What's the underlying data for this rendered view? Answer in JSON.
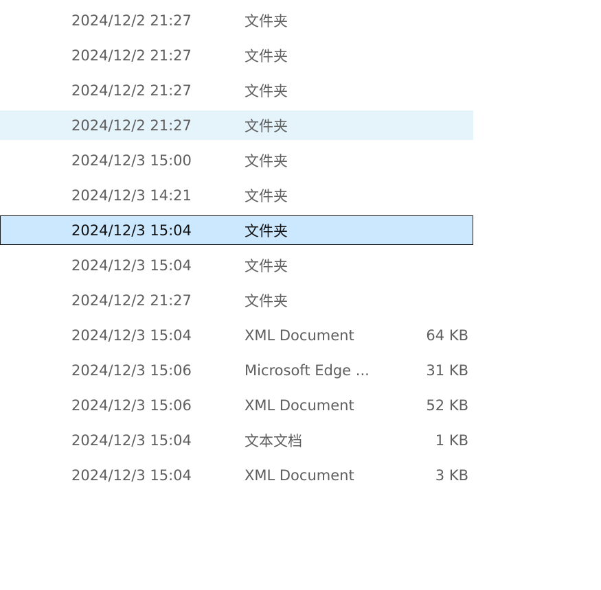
{
  "file_list": {
    "rows": [
      {
        "modified": "2024/12/2 21:27",
        "type": "文件夹",
        "size": "",
        "state": "normal"
      },
      {
        "modified": "2024/12/2 21:27",
        "type": "文件夹",
        "size": "",
        "state": "normal"
      },
      {
        "modified": "2024/12/2 21:27",
        "type": "文件夹",
        "size": "",
        "state": "normal"
      },
      {
        "modified": "2024/12/2 21:27",
        "type": "文件夹",
        "size": "",
        "state": "hover"
      },
      {
        "modified": "2024/12/3 15:00",
        "type": "文件夹",
        "size": "",
        "state": "normal"
      },
      {
        "modified": "2024/12/3 14:21",
        "type": "文件夹",
        "size": "",
        "state": "normal"
      },
      {
        "modified": "2024/12/3 15:04",
        "type": "文件夹",
        "size": "",
        "state": "selected"
      },
      {
        "modified": "2024/12/3 15:04",
        "type": "文件夹",
        "size": "",
        "state": "normal"
      },
      {
        "modified": "2024/12/2 21:27",
        "type": "文件夹",
        "size": "",
        "state": "normal"
      },
      {
        "modified": "2024/12/3 15:04",
        "type": "XML Document",
        "size": "64 KB",
        "state": "normal"
      },
      {
        "modified": "2024/12/3 15:06",
        "type": "Microsoft Edge ...",
        "size": "31 KB",
        "state": "normal"
      },
      {
        "modified": "2024/12/3 15:06",
        "type": "XML Document",
        "size": "52 KB",
        "state": "normal"
      },
      {
        "modified": "2024/12/3 15:04",
        "type": "文本文档",
        "size": "1 KB",
        "state": "normal"
      },
      {
        "modified": "2024/12/3 15:04",
        "type": "XML Document",
        "size": "3 KB",
        "state": "normal"
      }
    ]
  },
  "colors": {
    "text": "#5f5f5f",
    "hover_bg": "#e5f3fb",
    "selected_bg": "#cce8ff",
    "selected_border": "#1b1b1b"
  }
}
